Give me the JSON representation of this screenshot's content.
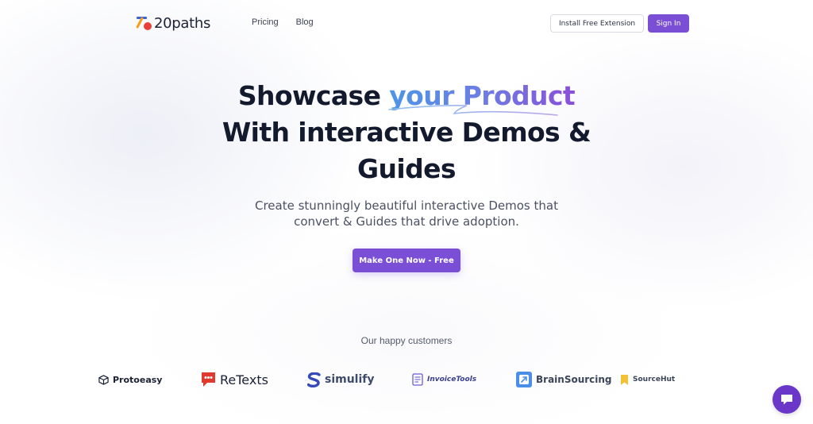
{
  "brand": {
    "name": "20paths"
  },
  "nav": {
    "items": [
      "Pricing",
      "Blog"
    ]
  },
  "header": {
    "extension_label": "Install Free Extension",
    "signin_label": "Sign In"
  },
  "hero": {
    "title_part1": "Showcase ",
    "title_highlight": "your Product",
    "title_line2": "With interactive Demos &",
    "title_line3": "Guides",
    "subtitle_line1": "Create stunningly beautiful interactive Demos that",
    "subtitle_line2": "convert & Guides that drive adoption.",
    "cta_label": "Make One Now - Free"
  },
  "customers": {
    "title": "Our happy customers",
    "logos": [
      {
        "name": "Protoeasy",
        "icon": "cube-icon"
      },
      {
        "name": "ReTexts",
        "icon": "chat-bubble-icon"
      },
      {
        "name": "simulify",
        "icon": "s-letter-icon"
      },
      {
        "name": "InvoiceTools",
        "icon": "receipt-icon"
      },
      {
        "name": "BrainSourcing",
        "icon": "square-arrow-icon"
      },
      {
        "name": "SourceHut",
        "icon": "bookmark-icon"
      }
    ]
  },
  "colors": {
    "accent": "#7a4fd6",
    "text": "#141a2e",
    "gradient_start": "#4d96e6",
    "gradient_end": "#8a4fd8"
  },
  "chat": {
    "icon": "chat-icon"
  }
}
